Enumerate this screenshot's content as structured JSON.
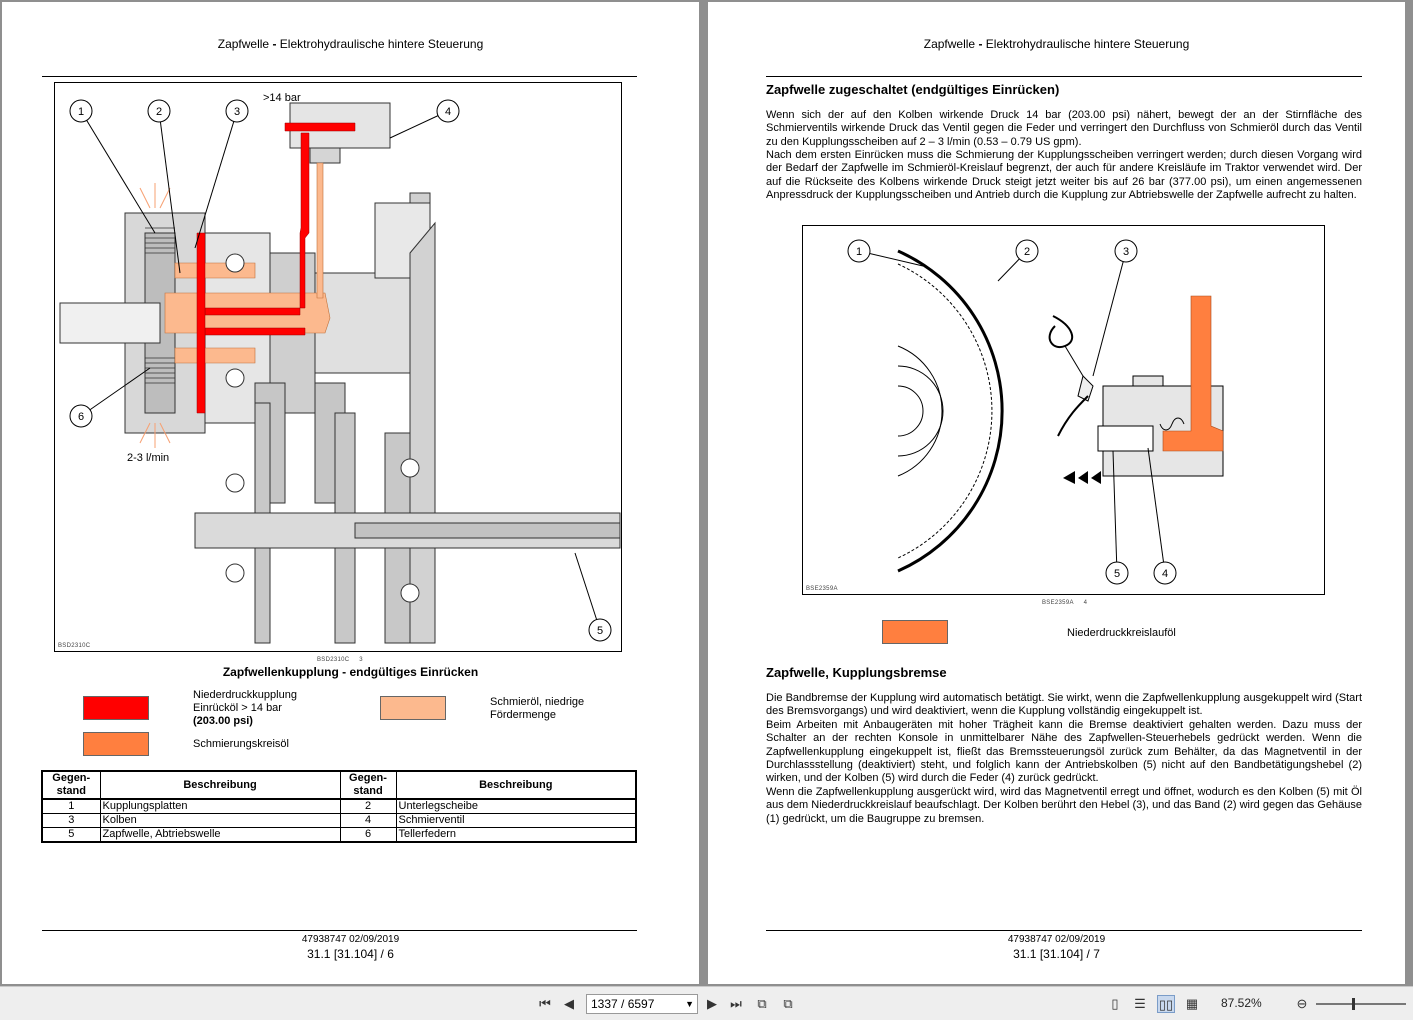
{
  "left_page": {
    "header_prefix": "Zapfwelle",
    "header_sep": " - ",
    "header_suffix": "Elektrohydraulische hintere Steuerung",
    "figure": {
      "label_pressure": ">14 bar",
      "label_flow": "2-3 l/min",
      "callouts": [
        "1",
        "2",
        "3",
        "4",
        "5",
        "6"
      ],
      "figure_id": "BSD2310C",
      "figure_ref": "BSD2310C",
      "figure_num": "3",
      "caption": "Zapfwellenkupplung - endgültiges Einrücken"
    },
    "legend": {
      "red_line1": "Niederdruckkupplung",
      "red_line2": "Einrücköl > 14 bar",
      "red_line3": "(203.00 psi)",
      "peach_line1": "Schmieröl, niedrige",
      "peach_line2": "Fördermenge",
      "orange": "Schmierungskreisöl",
      "colors": {
        "red": "#ff0000",
        "peach": "#fcb98e",
        "orange": "#ff7f3f"
      }
    },
    "table": {
      "headers": [
        "Gegen-stand",
        "Beschreibung",
        "Gegen-stand",
        "Beschreibung"
      ],
      "rows": [
        [
          "1",
          "Kupplungsplatten",
          "2",
          "Unterlegscheibe"
        ],
        [
          "3",
          "Kolben",
          "4",
          "Schmierventil"
        ],
        [
          "5",
          "Zapfwelle, Abtriebswelle",
          "6",
          "Tellerfedern"
        ]
      ]
    },
    "footer_doc": "47938747 02/09/2019",
    "footer_page": "31.1 [31.104] / 6"
  },
  "right_page": {
    "header_prefix": "Zapfwelle",
    "header_sep": " - ",
    "header_suffix": "Elektrohydraulische hintere Steuerung",
    "section1_title": "Zapfwelle zugeschaltet (endgültiges Einrücken)",
    "section1_p1": "Wenn sich der auf den Kolben wirkende Druck 14 bar (203.00 psi) nähert, bewegt der an der Stirnfläche des Schmierventils wirkende Druck das Ventil gegen die Feder und verringert den Durchfluss von Schmieröl durch das Ventil zu den Kupplungsscheiben auf 2 – 3 l/min (0.53 – 0.79 US gpm).",
    "section1_p2": "Nach dem ersten Einrücken muss die Schmierung der Kupplungsscheiben verringert werden; durch diesen Vorgang wird der Bedarf der Zapfwelle im Schmieröl-Kreislauf begrenzt, der auch für andere Kreisläufe im Traktor verwendet wird. Der auf die Rückseite des Kolbens wirkende Druck steigt jetzt weiter bis auf 26 bar (377.00 psi), um einen angemessenen Anpressdruck der Kupplungsscheiben und Antrieb durch die Kupplung zur Abtriebswelle der Zapfwelle aufrecht zu halten.",
    "figure": {
      "callouts": [
        "1",
        "2",
        "3",
        "4",
        "5"
      ],
      "figure_id": "BSE2359A",
      "figure_ref": "BSE2359A",
      "figure_num": "4"
    },
    "legend_orange": "Niederdruckkreislauföl",
    "section2_title": "Zapfwelle, Kupplungsbremse",
    "section2_p1": "Die Bandbremse der Kupplung wird automatisch betätigt. Sie wirkt, wenn die Zapfwellenkupplung ausgekuppelt wird (Start des Bremsvorgangs) und wird deaktiviert, wenn die Kupplung vollständig eingekuppelt ist.",
    "section2_p2": "Beim Arbeiten mit Anbaugeräten mit hoher Trägheit kann die Bremse deaktiviert gehalten werden. Dazu muss der Schalter an der rechten Konsole in unmittelbarer Nähe des Zapfwellen-Steuerhebels gedrückt werden. Wenn die Zapfwellenkupplung eingekuppelt ist, fließt das Bremssteuerungsöl zurück zum Behälter, da das Magnetventil in der Durchlassstellung (deaktiviert) steht, und folglich kann der Antriebskolben (5) nicht auf den Bandbetätigungshebel (2) wirken, und der Kolben (5) wird durch die Feder (4) zurück gedrückt.",
    "section2_p3": "Wenn die Zapfwellenkupplung ausgerückt wird, wird das Magnetventil erregt und öffnet, wodurch es den Kolben (5) mit Öl aus dem Niederdruckkreislauf beaufschlagt. Der Kolben berührt den Hebel (3), und das Band (2) wird gegen das Gehäuse (1) gedrückt, um die Baugruppe zu bremsen.",
    "footer_doc": "47938747 02/09/2019",
    "footer_page": "31.1 [31.104] / 7"
  },
  "toolbar": {
    "page_field": "1337 / 6597",
    "zoom": "87.52%"
  }
}
